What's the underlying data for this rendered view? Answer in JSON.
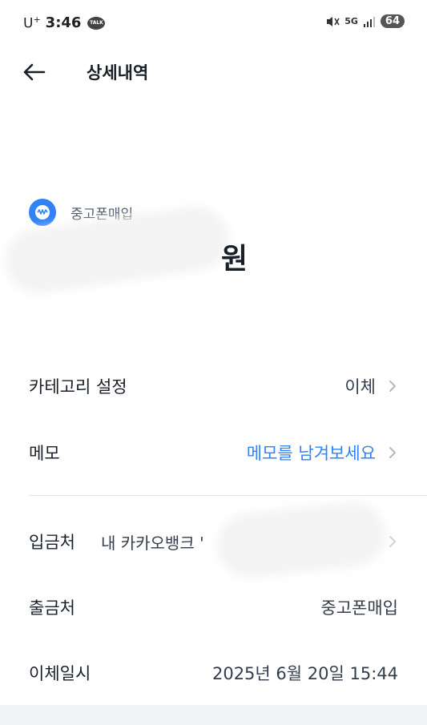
{
  "status_bar": {
    "carrier": "U",
    "carrier_sup": "+",
    "time": "3:46",
    "network": "5G",
    "battery": "64"
  },
  "header": {
    "title": "상세내역"
  },
  "merchant": {
    "name": "중고폰매입"
  },
  "amount": {
    "unit": "원"
  },
  "rows": {
    "category": {
      "label": "카테고리 설정",
      "value": "이체"
    },
    "memo": {
      "label": "메모",
      "value": "메모를 남겨보세요"
    },
    "deposit": {
      "label": "입금처",
      "value": "내 카카오뱅크 '"
    },
    "withdrawal": {
      "label": "출금처",
      "value": "중고폰매입"
    },
    "transfer_time": {
      "label": "이체일시",
      "value": "2025년 6월 20일 15:44"
    }
  },
  "colors": {
    "accent": "#3182f6",
    "text": "#191f28",
    "divider": "#e5e8eb"
  }
}
